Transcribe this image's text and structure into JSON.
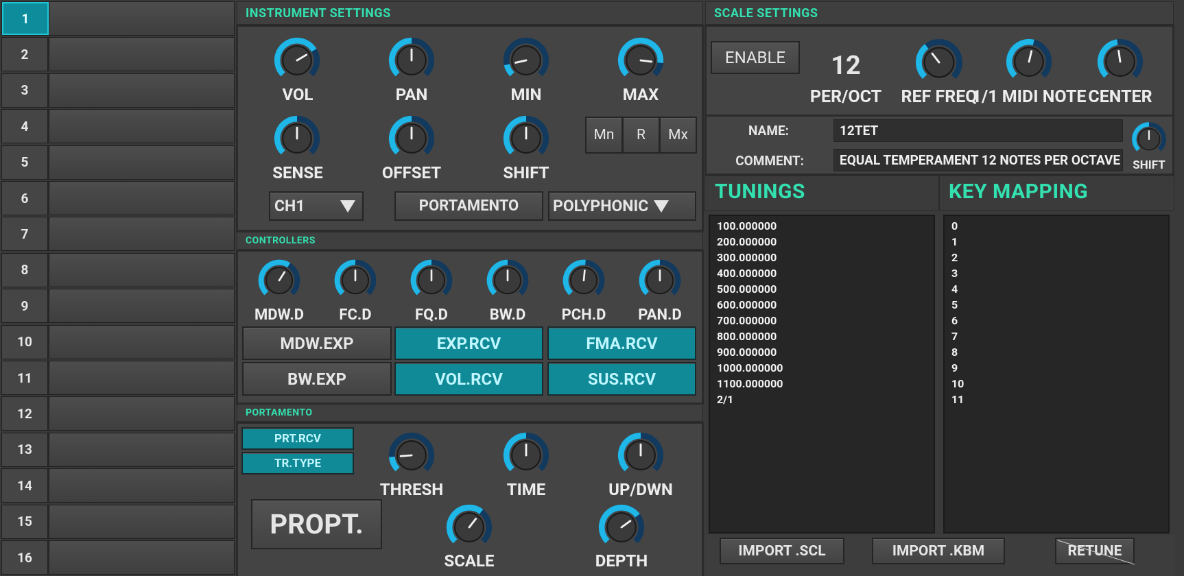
{
  "channels": [
    "1",
    "2",
    "3",
    "4",
    "5",
    "6",
    "7",
    "8",
    "9",
    "10",
    "11",
    "12",
    "13",
    "14",
    "15",
    "16"
  ],
  "selected_channel": "1",
  "instrument": {
    "title": "INSTRUMENT SETTINGS",
    "knobs": {
      "vol": {
        "label": "VOL",
        "value": 0.72
      },
      "pan": {
        "label": "PAN",
        "value": 0.5
      },
      "min": {
        "label": "MIN",
        "value": 0.12
      },
      "max": {
        "label": "MAX",
        "value": 0.86
      },
      "sense": {
        "label": "SENSE",
        "value": 0.5
      },
      "offset": {
        "label": "OFFSET",
        "value": 0.5
      },
      "shift": {
        "label": "SHIFT",
        "value": 0.5
      }
    },
    "mode_buttons": [
      "Mn",
      "R",
      "Mx"
    ],
    "channel_select": "CH1",
    "portamento_button": "PORTAMENTO",
    "voice_select": "POLYPHONIC"
  },
  "controllers": {
    "title": "CONTROLLERS",
    "knobs": [
      {
        "label": "MDW.D",
        "value": 0.62
      },
      {
        "label": "FC.D",
        "value": 0.5
      },
      {
        "label": "FQ.D",
        "value": 0.5
      },
      {
        "label": "BW.D",
        "value": 0.5
      },
      {
        "label": "PCH.D",
        "value": 0.52
      },
      {
        "label": "PAN.D",
        "value": 0.5
      }
    ],
    "buttons": {
      "mdw_exp": "MDW.EXP",
      "exp_rcv": "EXP.RCV",
      "fma_rcv": "FMA.RCV",
      "bw_exp": "BW.EXP",
      "vol_rcv": "VOL.RCV",
      "sus_rcv": "SUS.RCV"
    }
  },
  "portamento": {
    "title": "PORTAMENTO",
    "prt_rcv": "PRT.RCV",
    "tr_type": "TR.TYPE",
    "propt": "PROPT.",
    "knobs": {
      "thresh": {
        "label": "THRESH",
        "value": 0.15
      },
      "time": {
        "label": "TIME",
        "value": 0.5
      },
      "updwn": {
        "label": "UP/DWN",
        "value": 0.5
      },
      "scale": {
        "label": "SCALE",
        "value": 0.64
      },
      "depth": {
        "label": "DEPTH",
        "value": 0.7
      }
    }
  },
  "scale": {
    "title": "SCALE SETTINGS",
    "enable": "ENABLE",
    "per_oct_value": "12",
    "per_oct_label": "PER/OCT",
    "knobs": {
      "ref_freq": {
        "label": "REF FREQ",
        "value": 0.36
      },
      "midi_note": {
        "label": "1/1 MIDI NOTE",
        "value": 0.55
      },
      "center": {
        "label": "CENTER",
        "value": 0.47
      },
      "shift": {
        "label": "SHIFT",
        "value": 0.5
      }
    },
    "name_label": "NAME:",
    "name_value": "12TET",
    "comment_label": "COMMENT:",
    "comment_value": "EQUAL TEMPERAMENT 12 NOTES PER OCTAVE",
    "tunings_title": "TUNINGS",
    "tunings": [
      "100.000000",
      "200.000000",
      "300.000000",
      "400.000000",
      "500.000000",
      "600.000000",
      "700.000000",
      "800.000000",
      "900.000000",
      "1000.000000",
      "1100.000000",
      "2/1"
    ],
    "keymap_title": "KEY MAPPING",
    "key_mapping": [
      "0",
      "1",
      "2",
      "3",
      "4",
      "5",
      "6",
      "7",
      "8",
      "9",
      "10",
      "11"
    ],
    "import_scl": "IMPORT .SCL",
    "import_kbm": "IMPORT .KBM",
    "retune": "RETUNE"
  },
  "colors": {
    "accent": "#33e0b0",
    "knob_arc": "#1fb6e8",
    "knob_track": "#123a5e",
    "toggle_on": "#0f8a96"
  }
}
